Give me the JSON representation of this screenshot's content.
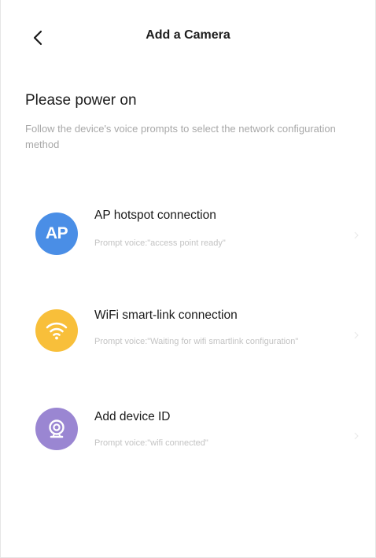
{
  "header": {
    "title": "Add a Camera",
    "back_icon": "chevron-left-icon"
  },
  "main": {
    "heading": "Please power on",
    "subtitle": "Follow the device's voice prompts to select the network configuration method",
    "options": [
      {
        "label": "AP hotspot connection",
        "description": "Prompt voice:\"access point ready\"",
        "icon": "ap-icon",
        "icon_text": "AP",
        "color": "#4a8ee6"
      },
      {
        "label": "WiFi smart-link connection",
        "description": "Prompt voice:\"Waiting for wifi smartlink configuration\"",
        "icon": "wifi-icon",
        "color": "#f8bf3a"
      },
      {
        "label": "Add device ID",
        "description": "Prompt voice:\"wifi connected\"",
        "icon": "camera-icon",
        "color": "#9a86d2"
      }
    ]
  }
}
